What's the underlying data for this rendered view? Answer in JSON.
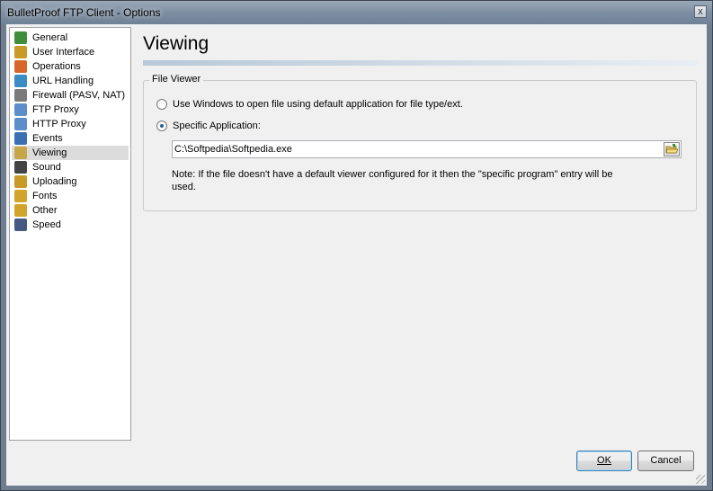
{
  "window": {
    "title": "BulletProof FTP Client - Options",
    "close_glyph": "x"
  },
  "sidebar": {
    "items": [
      {
        "label": "General",
        "icon": "general-icon",
        "color": "#3f8f3a"
      },
      {
        "label": "User Interface",
        "icon": "user-interface-icon",
        "color": "#c99a28"
      },
      {
        "label": "Operations",
        "icon": "operations-icon",
        "color": "#d7662b"
      },
      {
        "label": "URL Handling",
        "icon": "url-handling-icon",
        "color": "#3b8bc4"
      },
      {
        "label": "Firewall (PASV, NAT)",
        "icon": "firewall-icon",
        "color": "#7a7a7a"
      },
      {
        "label": "FTP Proxy",
        "icon": "ftp-proxy-icon",
        "color": "#5c8fc9"
      },
      {
        "label": "HTTP Proxy",
        "icon": "http-proxy-icon",
        "color": "#5c8fc9"
      },
      {
        "label": "Events",
        "icon": "events-icon",
        "color": "#3a6fb4"
      },
      {
        "label": "Viewing",
        "icon": "magnifier-icon",
        "color": "#c7a64a"
      },
      {
        "label": "Sound",
        "icon": "sound-icon",
        "color": "#444444"
      },
      {
        "label": "Uploading",
        "icon": "uploading-icon",
        "color": "#c79a2a"
      },
      {
        "label": "Fonts",
        "icon": "fonts-icon",
        "color": "#d2a42c"
      },
      {
        "label": "Other",
        "icon": "other-icon",
        "color": "#d2a42c"
      },
      {
        "label": "Speed",
        "icon": "speed-icon",
        "color": "#445a82"
      }
    ],
    "selected_index": 8
  },
  "page": {
    "title": "Viewing"
  },
  "file_viewer": {
    "legend": "File Viewer",
    "option_windows": "Use Windows to open file using default application for file type/ext.",
    "option_specific": "Specific Application:",
    "selected_option": "specific",
    "path_value": "C:\\Softpedia\\Softpedia.exe",
    "note": "Note: If the file doesn't have a default viewer configured for it then the \"specific program\" entry will be used."
  },
  "buttons": {
    "ok": "OK",
    "cancel": "Cancel"
  }
}
